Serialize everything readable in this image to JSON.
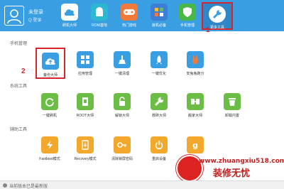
{
  "user": {
    "name": "未登录",
    "status": "Q 登录"
  },
  "nav": [
    {
      "label": "刷机大师",
      "icon": "cloud-icon",
      "color": "#3a9ee2"
    },
    {
      "label": "ROM基地",
      "icon": "android-icon",
      "color": "#2eb7d0"
    },
    {
      "label": "热门游戏",
      "icon": "gamepad-icon",
      "color": "#f07a3a"
    },
    {
      "label": "装机必备",
      "icon": "apps-icon",
      "color": "#3d7fd6"
    },
    {
      "label": "手机管理",
      "icon": "shield-icon",
      "color": "#4bb648"
    },
    {
      "label": "更多工具",
      "icon": "wrench-icon",
      "color": "#3a9ee2"
    }
  ],
  "annotations": {
    "one": "1",
    "two": "2"
  },
  "sections": {
    "phone": {
      "title": "手机管理",
      "items": [
        {
          "label": "备份大师",
          "icon": "cloud-upload-icon",
          "color": "#3a9ee2"
        },
        {
          "label": "应用管理",
          "icon": "grid-icon",
          "color": "#3a9ee2"
        },
        {
          "label": "一键清理",
          "icon": "broom-icon",
          "color": "#3a9ee2"
        },
        {
          "label": "一键优化",
          "icon": "rocket-icon",
          "color": "#3a9ee2"
        },
        {
          "label": "安兔兔跑分",
          "icon": "bunny-icon",
          "color": "#3a9ee2"
        }
      ]
    },
    "system": {
      "title": "系统工具",
      "items": [
        {
          "label": "一键刷机",
          "icon": "refresh-icon",
          "color": "#6cbd45"
        },
        {
          "label": "ROOT大师",
          "icon": "root-icon",
          "color": "#6cbd45"
        },
        {
          "label": "解锁大师",
          "icon": "unlock-icon",
          "color": "#6cbd45"
        },
        {
          "label": "救砖大师",
          "icon": "wrench-icon",
          "color": "#6cbd45"
        },
        {
          "label": "搬家大师",
          "icon": "move-icon",
          "color": "#6cbd45"
        },
        {
          "label": "卸载内置",
          "icon": "trash-icon",
          "color": "#6cbd45"
        }
      ]
    },
    "aux": {
      "title": "辅助工具",
      "items": [
        {
          "label": "Fastboot模式",
          "icon": "lightning-icon",
          "color": "#f1a82b"
        },
        {
          "label": "Recovery模式",
          "icon": "phone-icon",
          "color": "#f1a82b"
        },
        {
          "label": "清除锁屏密码",
          "icon": "key-icon",
          "color": "#f1a82b"
        },
        {
          "label": "重启设备",
          "icon": "power-icon",
          "color": "#f1a82b"
        },
        {
          "label": "你的",
          "icon": "g-icon",
          "color": "#f1a82b"
        }
      ]
    }
  },
  "status": {
    "text": "当前版本已是最新版"
  },
  "watermark": {
    "url": "www.zhuangxiu518.com",
    "text": "装修无忧"
  }
}
